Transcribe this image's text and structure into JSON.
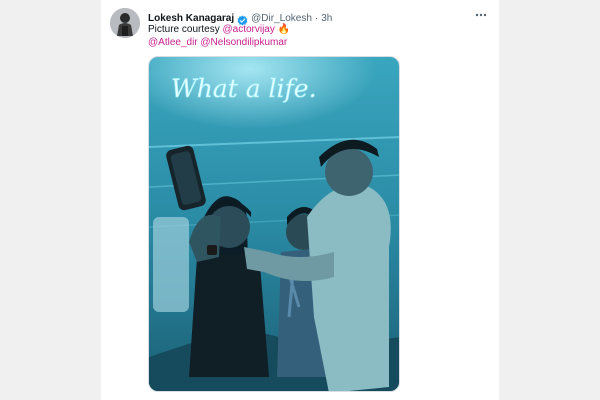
{
  "tweet": {
    "author_name": "Lokesh Kanagaraj",
    "handle": "@Dir_Lokesh",
    "separator": "·",
    "time": "3h",
    "text_prefix": "Picture courtesy ",
    "mentions": [
      "@actorvijay",
      "@Atlee_dir",
      "@Nelsondilipkumar"
    ],
    "emoji": "🔥",
    "media": {
      "neon_sign_text": "What a life."
    }
  },
  "icons": {
    "verified": "verified-badge-icon",
    "more": "more-options-icon"
  },
  "colors": {
    "mention": "#c81f8c",
    "verified": "#1d9bf0",
    "text": "#0f1419",
    "secondary": "#536471",
    "neon_bg": "#2d8fa7"
  }
}
